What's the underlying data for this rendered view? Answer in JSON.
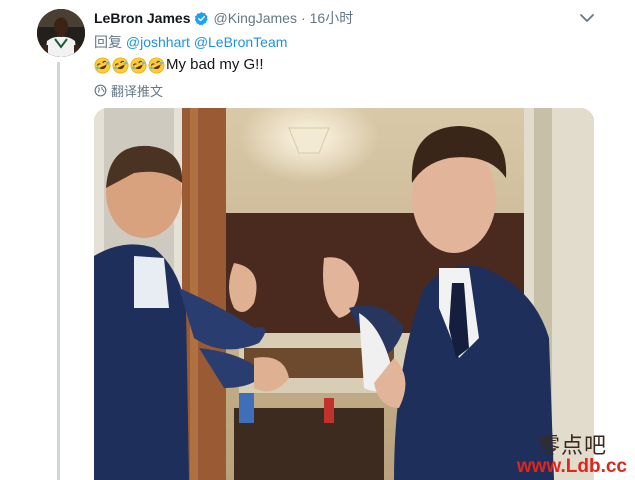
{
  "tweet": {
    "author_name": "LeBron James",
    "verified": true,
    "handle": "@KingJames",
    "separator": "·",
    "time": "16小时",
    "reply_prefix": "回复",
    "reply_mentions": [
      "@joshhart",
      "@LeBronTeam"
    ],
    "emoji_count": 4,
    "emoji_name": "rolling-on-floor-laughing",
    "text": "My bad my G!!",
    "translate_label": "翻译推文"
  },
  "watermark": {
    "top": "零点吧",
    "bottom": "www.Ldb.cc"
  },
  "colors": {
    "link": "#1b95e0",
    "secondary_text": "#657786",
    "verified_badge": "#1da1f2",
    "thread_line": "#ccd6dd",
    "watermark_red": "#e0251c"
  }
}
